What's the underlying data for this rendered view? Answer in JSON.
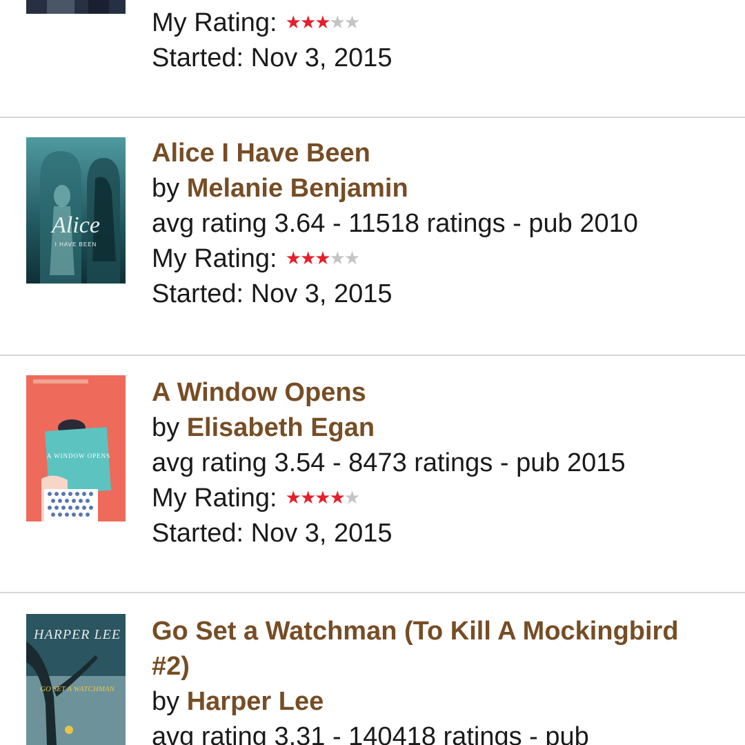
{
  "books": [
    {
      "title": "",
      "author_prefix": "",
      "author": "",
      "meta": "",
      "my_rating_label": "My Rating:",
      "my_rating": 3,
      "started": "Started: Nov 3, 2015",
      "cover_colors": [
        "#1e2532",
        "#3b4556"
      ]
    },
    {
      "title": "Alice I Have Been",
      "author_prefix": "by",
      "author": "Melanie Benjamin",
      "meta": "avg rating 3.64 - 11518 ratings - pub 2010",
      "my_rating_label": "My Rating:",
      "my_rating": 3,
      "started": "Started: Nov 3, 2015",
      "cover_text": "Alice",
      "cover_subtext": "I HAVE BEEN",
      "cover_colors": [
        "#18434d",
        "#4b8f94"
      ]
    },
    {
      "title": "A Window Opens",
      "author_prefix": "by",
      "author": "Elisabeth Egan",
      "meta": "avg rating 3.54 - 8473 ratings - pub 2015",
      "my_rating_label": "My Rating:",
      "my_rating": 4,
      "started": "Started: Nov 3, 2015",
      "cover_text": "A WINDOW OPENS",
      "cover_colors": [
        "#ee6a5a",
        "#58c0bd"
      ]
    },
    {
      "title": "Go Set a Watchman (To Kill A Mockingbird #2)",
      "author_prefix": "by",
      "author": "Harper Lee",
      "meta": "avg rating 3.31 - 140418 ratings - pub",
      "cover_text": "HARPER LEE",
      "cover_subtext": "GO SET A WATCHMAN",
      "cover_colors": [
        "#22414c",
        "#6a8c93"
      ]
    }
  ],
  "stars_max": 5
}
